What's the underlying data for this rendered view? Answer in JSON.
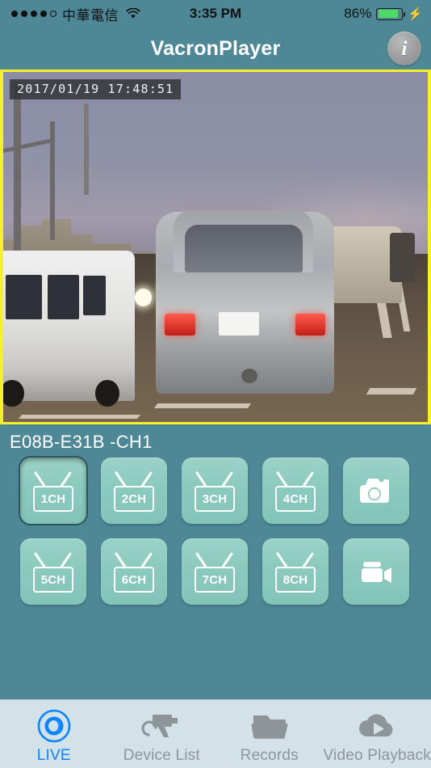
{
  "status_bar": {
    "signal_dots_filled": 4,
    "signal_dots_total": 5,
    "carrier": "中華電信",
    "wifi_icon": "wifi-icon",
    "time": "3:35 PM",
    "battery_percent": "86%",
    "battery_level": 86,
    "battery_color": "#4cd964",
    "charging_icon": "lightning-bolt-icon"
  },
  "nav": {
    "title": "VacronPlayer",
    "info_button_label": "i",
    "info_icon": "info-circle-icon"
  },
  "video": {
    "timestamp_overlay": "2017/01/19 17:48:51",
    "border_color": "#f5f02a",
    "description": "live dashcam street view"
  },
  "panel": {
    "device_label": "E08B-E31B -CH1",
    "background_color": "#4e8897",
    "button_color": "#8ac9bd",
    "channels": [
      {
        "label": "1CH",
        "icon": "tv-icon",
        "selected": true
      },
      {
        "label": "2CH",
        "icon": "tv-icon",
        "selected": false
      },
      {
        "label": "3CH",
        "icon": "tv-icon",
        "selected": false
      },
      {
        "label": "4CH",
        "icon": "tv-icon",
        "selected": false
      },
      {
        "label": "5CH",
        "icon": "tv-icon",
        "selected": false
      },
      {
        "label": "6CH",
        "icon": "tv-icon",
        "selected": false
      },
      {
        "label": "7CH",
        "icon": "tv-icon",
        "selected": false
      },
      {
        "label": "8CH",
        "icon": "tv-icon",
        "selected": false
      }
    ],
    "snapshot_button": {
      "icon": "camera-icon"
    },
    "record_button": {
      "icon": "video-camera-icon"
    }
  },
  "tab_bar": {
    "background_color": "#d2e2e8",
    "active_color": "#0a84ff",
    "inactive_color": "#8e9598",
    "tabs": [
      {
        "label": "LIVE",
        "icon": "live-lens-icon",
        "active": true
      },
      {
        "label": "Device List",
        "icon": "cctv-camera-icon",
        "active": false
      },
      {
        "label": "Records",
        "icon": "folder-icon",
        "active": false
      },
      {
        "label": "Video Playback",
        "icon": "cloud-play-icon",
        "active": false
      }
    ]
  }
}
